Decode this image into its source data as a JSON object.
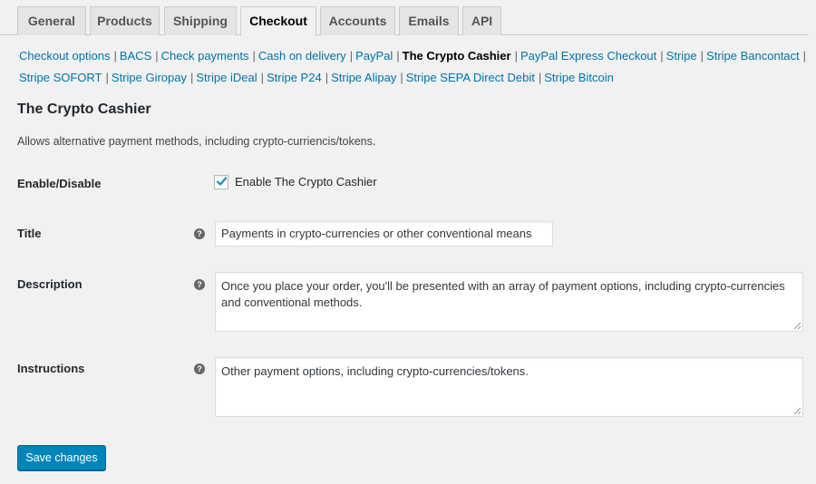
{
  "tabs": [
    {
      "label": "General"
    },
    {
      "label": "Products"
    },
    {
      "label": "Shipping"
    },
    {
      "label": "Checkout",
      "active": true
    },
    {
      "label": "Accounts"
    },
    {
      "label": "Emails"
    },
    {
      "label": "API"
    }
  ],
  "subnav": {
    "row1": [
      "Checkout options",
      "BACS",
      "Check payments",
      "Cash on delivery",
      "PayPal",
      "The Crypto Cashier",
      "PayPal Express Checkout",
      "Stripe",
      "Stripe Bancontact"
    ],
    "row2": [
      "Stripe SOFORT",
      "Stripe Giropay",
      "Stripe iDeal",
      "Stripe P24",
      "Stripe Alipay",
      "Stripe SEPA Direct Debit",
      "Stripe Bitcoin"
    ],
    "current": "The Crypto Cashier",
    "separator": "|"
  },
  "section": {
    "title": "The Crypto Cashier",
    "description": "Allows alternative payment methods, including crypto-curriencis/tokens."
  },
  "fields": {
    "enable": {
      "label": "Enable/Disable",
      "checkbox_label": "Enable The Crypto Cashier",
      "checked": true
    },
    "title": {
      "label": "Title",
      "value": "Payments in crypto-currencies or other conventional means"
    },
    "description": {
      "label": "Description",
      "value": "Once you place your order, you'll be presented with an array of payment options, including crypto-currencies and conventional methods."
    },
    "instructions": {
      "label": "Instructions",
      "value": "Other payment options, including crypto-currencies/tokens."
    }
  },
  "help_icon_glyph": "?",
  "save_button_label": "Save changes",
  "colors": {
    "link": "#0073aa",
    "primary_button": "#0085ba",
    "background": "#f1f1f1"
  },
  "icons": [
    "question-circle-icon",
    "checkmark-icon",
    "resize-grip-icon"
  ]
}
